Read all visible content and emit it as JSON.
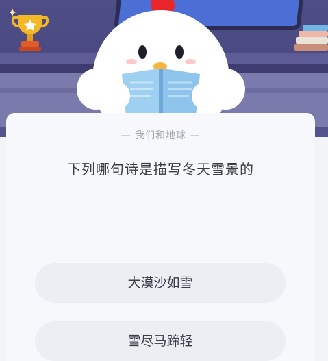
{
  "quiz": {
    "category": "— 我们和地球 —",
    "question": "下列哪句诗是描写冬天雪景的",
    "options": [
      {
        "label": "大漠沙如雪"
      },
      {
        "label": "雪尽马蹄轻"
      }
    ]
  },
  "colors": {
    "scene_background": "#4f4d86",
    "card_background": "#f7f8fb",
    "option_background": "#eceef3",
    "text_primary": "#3a3d45",
    "text_muted": "#a3a8b4",
    "chick_comb": "#e8262a",
    "trophy_gold": "#f4b824"
  },
  "icons": {
    "trophy": "trophy-icon",
    "books": "books-icon",
    "mascot": "chick-mascot"
  }
}
